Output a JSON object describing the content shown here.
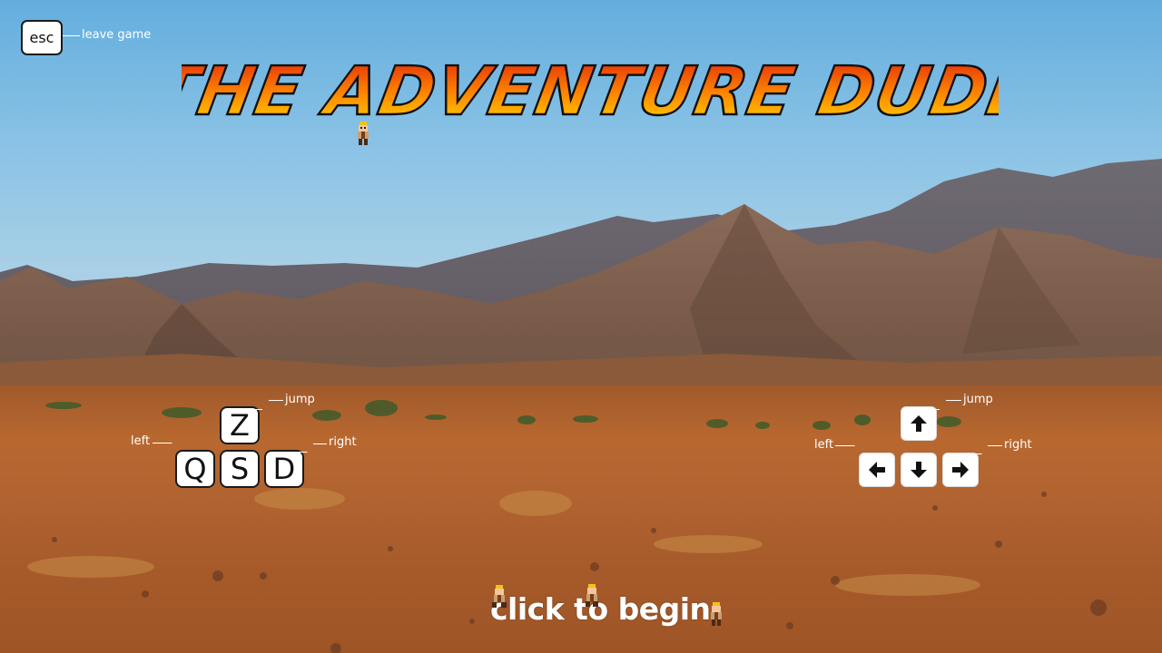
{
  "game": {
    "title": "THE ADVENTURE DUDE",
    "start_prompt": "click to begin"
  },
  "esc_control": {
    "key": "esc",
    "label": "leave game"
  },
  "keyboard_controls": {
    "jump_key": "Z",
    "left_key": "Q",
    "down_key": "S",
    "right_key": "D",
    "jump_label": "jump",
    "left_label": "left",
    "right_label": "right"
  },
  "arrow_controls": {
    "up_icon": "arrow-up-icon",
    "left_icon": "arrow-left-icon",
    "down_icon": "arrow-down-icon",
    "right_icon": "arrow-right-icon",
    "jump_label": "jump",
    "left_label": "left",
    "right_label": "right"
  },
  "colors": {
    "title_top": "#e0200a",
    "title_bottom": "#ffe000",
    "sky": "#63aede",
    "ground": "#b0622f"
  }
}
